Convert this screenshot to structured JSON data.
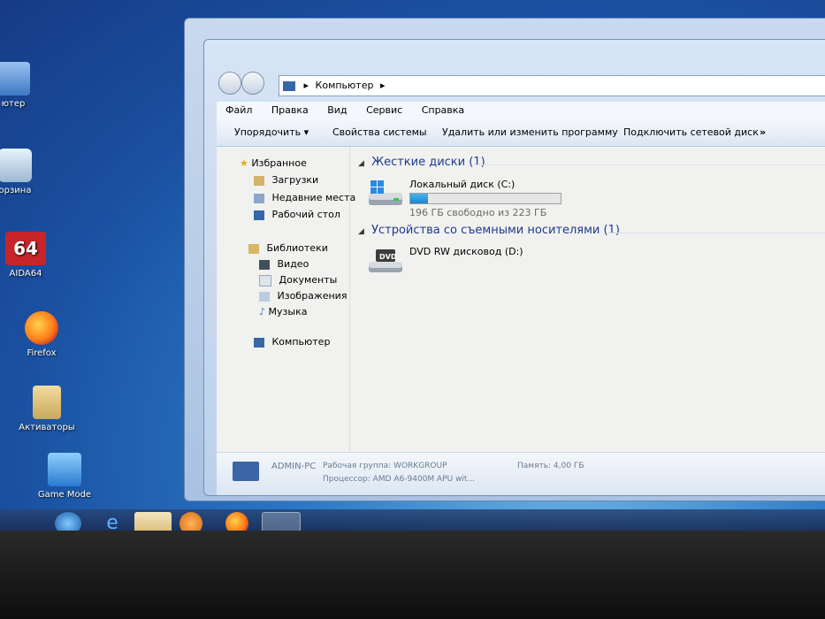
{
  "desktop": {
    "icons": [
      {
        "label": "ютер",
        "icon": "computer-icon"
      },
      {
        "label": "орзина",
        "icon": "recycle-bin-icon"
      },
      {
        "label": "AIDA64",
        "icon": "aida64-icon",
        "badge": "64"
      },
      {
        "label": "Firefox",
        "icon": "firefox-icon"
      },
      {
        "label": "Активаторы",
        "icon": "folder-icon"
      },
      {
        "label": "Game Mode",
        "icon": "game-mode-icon"
      }
    ]
  },
  "window": {
    "address": {
      "segments": [
        "Компьютер"
      ]
    },
    "menu": [
      "Файл",
      "Правка",
      "Вид",
      "Сервис",
      "Справка"
    ],
    "toolbar": {
      "organize": "Упорядочить",
      "system_props": "Свойства системы",
      "uninstall": "Удалить или изменить программу",
      "map_drive": "Подключить сетевой диск",
      "more": "»"
    },
    "nav": {
      "favorites": "Избранное",
      "downloads": "Загрузки",
      "recent": "Недавние места",
      "desktop": "Рабочий стол",
      "libraries": "Библиотеки",
      "video": "Видео",
      "documents": "Документы",
      "images": "Изображения",
      "music": "Музыка",
      "computer": "Компьютер"
    },
    "groups": {
      "hdd": {
        "title": "Жесткие диски (1)",
        "drive_name": "Локальный диск (C:)",
        "free_text": "196 ГБ свободно из 223 ГБ",
        "used_fraction": 0.12
      },
      "removable": {
        "title": "Устройства со съемными носителями (1)",
        "drive_name": "DVD RW дисковод (D:)",
        "dvd_badge": "DVD"
      }
    },
    "details": {
      "pc_name": "ADMIN-PC",
      "workgroup": "Рабочая группа: WORKGROUP",
      "memory": "Память: 4,00 ГБ",
      "processor": "Процессор: AMD A6-9400M APU wit..."
    }
  },
  "colors": {
    "accent": "#1e3b8a",
    "bar": "#2a9ae0"
  }
}
